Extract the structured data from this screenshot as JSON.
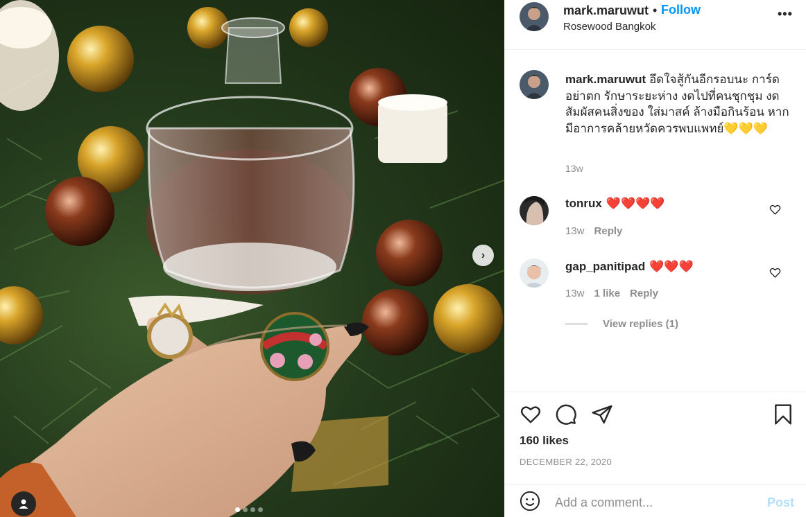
{
  "header": {
    "username": "mark.maruwut",
    "separator": "•",
    "follow_label": "Follow",
    "location": "Rosewood Bangkok",
    "more_label": "•••"
  },
  "caption": {
    "username": "mark.maruwut",
    "text": "อึดใจสู้กันอีกรอบนะ การ์ดอย่าตก รักษาระยะห่าง งดไปที่คนชุกชุม งดสัมผัสคนสิ่งของ ใส่มาสค์ ล้างมือกินร้อน หากมีอาการคล้ายหวัดควรพบแพทย์",
    "emoji": "💛💛💛",
    "time": "13w"
  },
  "comments": [
    {
      "username": "tonrux",
      "emoji": "❤️❤️❤️❤️",
      "time": "13w",
      "likes": "",
      "reply_label": "Reply"
    },
    {
      "username": "gap_panitipad",
      "emoji": "❤️❤️❤️",
      "time": "13w",
      "likes": "1 like",
      "reply_label": "Reply"
    }
  ],
  "view_replies_label": "View replies (1)",
  "likes_label": "160 likes",
  "date": "DECEMBER 22, 2020",
  "comment_box": {
    "placeholder": "Add a comment...",
    "post_label": "Post"
  },
  "carousel": {
    "current": 1,
    "total": 4
  },
  "icons": {
    "like": "heart-icon",
    "comment": "comment-bubble-icon",
    "share": "paper-plane-icon",
    "save": "bookmark-icon",
    "emoji": "smiley-icon",
    "next": "chevron-right-icon",
    "tag": "user-tag-icon"
  },
  "colors": {
    "accent": "#0095f6",
    "post_disabled": "#b2dffc",
    "muted": "#8e8e8e",
    "text": "#262626"
  }
}
